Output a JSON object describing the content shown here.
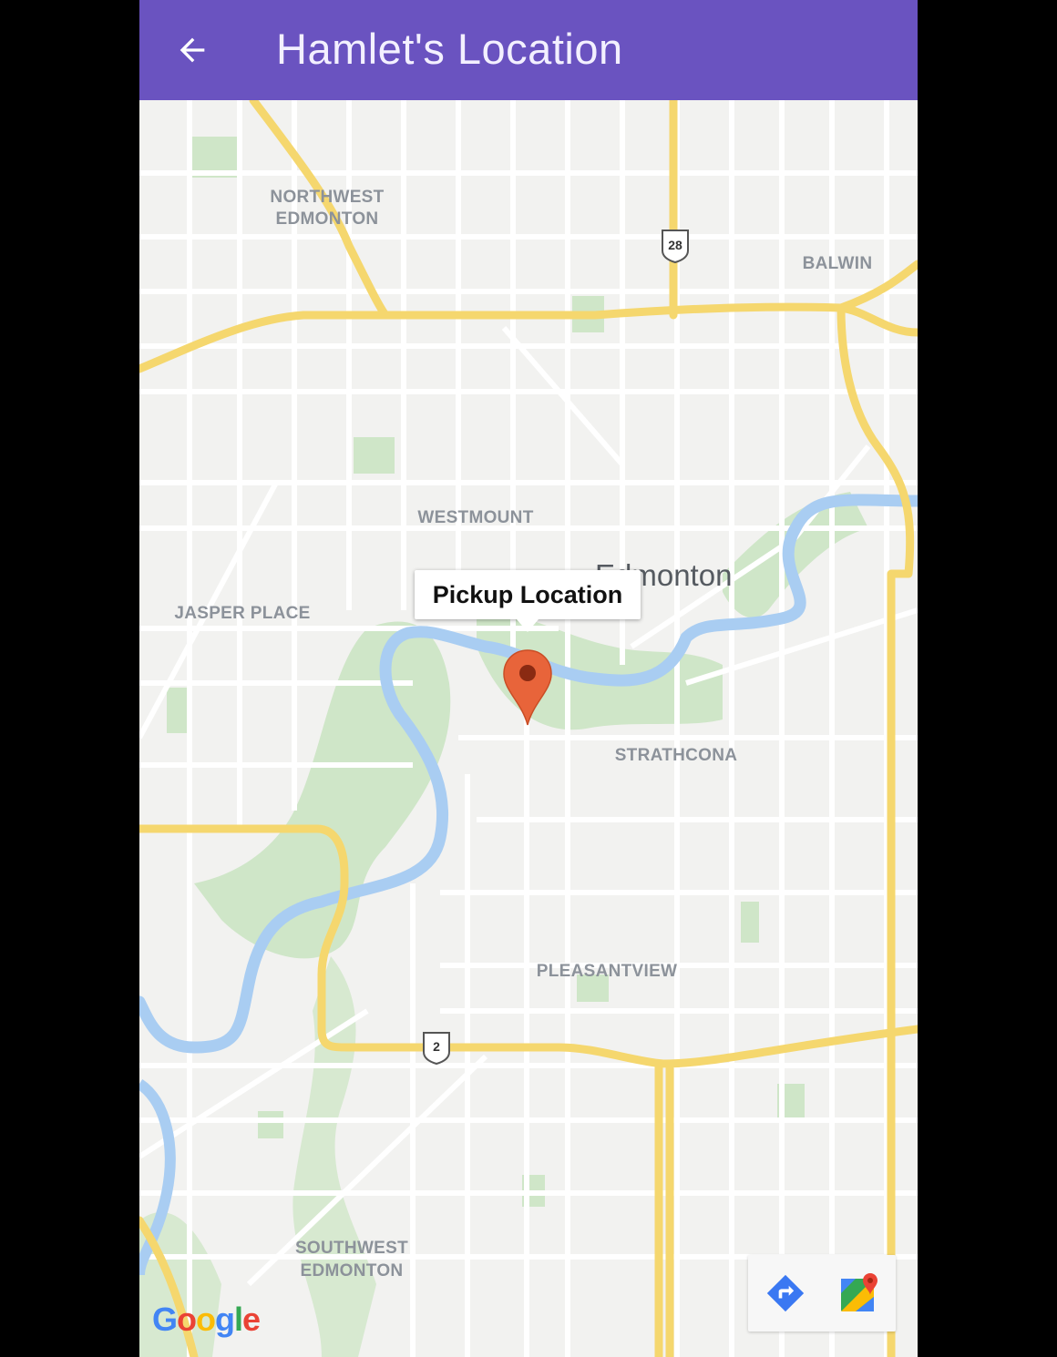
{
  "app_bar": {
    "title": "Hamlet's Location",
    "back_icon": "arrow-back-icon",
    "background_color": "#6a53c0"
  },
  "map": {
    "area_labels": [
      {
        "name": "northwest",
        "lines": [
          "NORTHWEST",
          "EDMONTON"
        ]
      },
      {
        "name": "balwin",
        "lines": [
          "BALWIN"
        ]
      },
      {
        "name": "westmount",
        "lines": [
          "WESTMOUNT"
        ]
      },
      {
        "name": "jasper-place",
        "lines": [
          "JASPER PLACE"
        ]
      },
      {
        "name": "strathcona",
        "lines": [
          "STRATHCONA"
        ]
      },
      {
        "name": "pleasantview",
        "lines": [
          "PLEASANTVIEW"
        ]
      },
      {
        "name": "southwest",
        "lines": [
          "SOUTHWEST",
          "EDMONTON"
        ]
      }
    ],
    "city_label": "Edmonton",
    "highway_shields": [
      "28",
      "2"
    ],
    "road_color": "#f5d76e",
    "river_color": "#a9cdf2",
    "park_color": "#cfe6c8"
  },
  "marker": {
    "info_window_title": "Pickup Location",
    "pin_icon": "map-pin-icon",
    "pin_color": "#e8643a"
  },
  "toolbar": {
    "directions_icon": "directions-icon",
    "open_in_maps_icon": "google-maps-icon"
  },
  "attribution": {
    "logo_letters": [
      "G",
      "o",
      "o",
      "g",
      "l",
      "e"
    ],
    "logo_colors": [
      "#4285f4",
      "#ea4335",
      "#fbbc05",
      "#4285f4",
      "#34a853",
      "#ea4335"
    ]
  }
}
